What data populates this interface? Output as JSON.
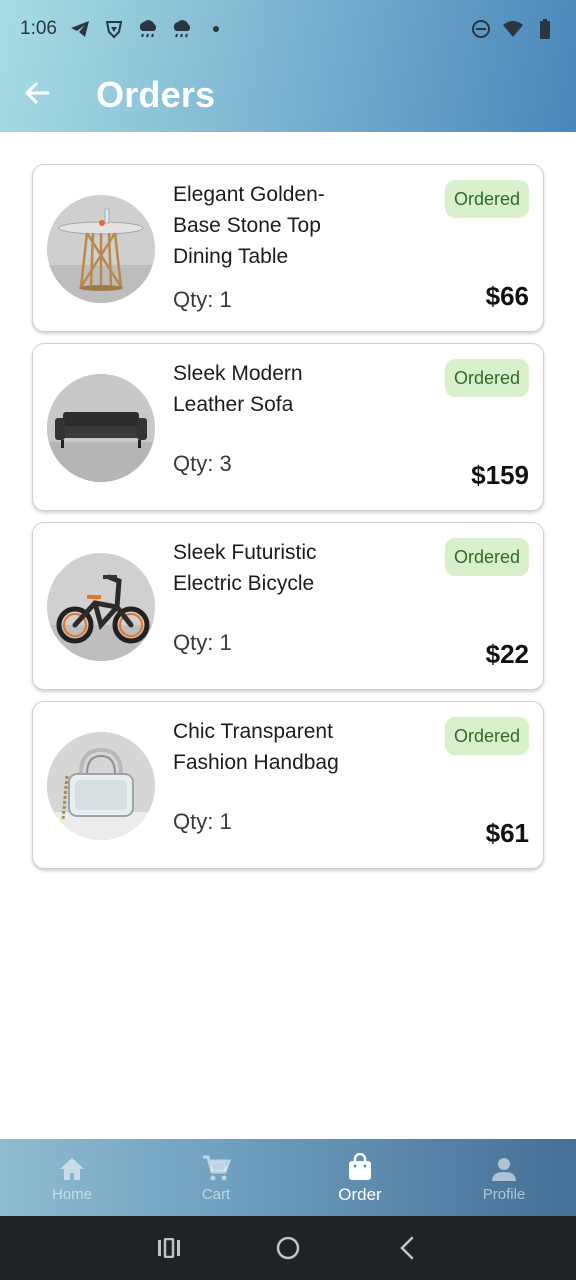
{
  "status_bar": {
    "time": "1:06",
    "icons_left": [
      "telegram-icon",
      "brave-icon",
      "weather-icon",
      "weather-icon",
      "dot-icon"
    ],
    "icons_right": [
      "dnd-icon",
      "wifi-icon",
      "battery-icon"
    ]
  },
  "header": {
    "title": "Orders",
    "back_icon": "arrow-left-icon",
    "gradient": [
      "#a7dde3",
      "#4a86ba"
    ]
  },
  "orders": [
    {
      "name_lines": [
        "Elegant Golden-",
        "Base Stone Top",
        "Dining Table"
      ],
      "qty_label": "Qty:",
      "qty": "1",
      "status": "Ordered",
      "price": "$66",
      "image": "dining-table-image"
    },
    {
      "name_lines": [
        "Sleek Modern",
        "Leather Sofa"
      ],
      "qty_label": "Qty:",
      "qty": "3",
      "status": "Ordered",
      "price": "$159",
      "image": "leather-sofa-image"
    },
    {
      "name_lines": [
        "Sleek Futuristic",
        "Electric Bicycle"
      ],
      "qty_label": "Qty:",
      "qty": "1",
      "status": "Ordered",
      "price": "$22",
      "image": "electric-bicycle-image"
    },
    {
      "name_lines": [
        "Chic Transparent",
        "Fashion Handbag"
      ],
      "qty_label": "Qty:",
      "qty": "1",
      "status": "Ordered",
      "price": "$61",
      "image": "handbag-image"
    }
  ],
  "bottom_nav": {
    "items": [
      {
        "label": "Home",
        "icon": "home-icon",
        "active": false
      },
      {
        "label": "Cart",
        "icon": "cart-icon",
        "active": false
      },
      {
        "label": "Order",
        "icon": "shopping-bag-icon",
        "active": true
      },
      {
        "label": "Profile",
        "icon": "person-icon",
        "active": false
      }
    ]
  },
  "system_nav": [
    "recents-icon",
    "home-circle-icon",
    "back-chevron-icon"
  ],
  "colors": {
    "badge_bg": "#d9f0cc",
    "badge_text": "#2e6b2a",
    "nav_gradient_start": "#8fbcd0",
    "nav_gradient_end": "#456f96"
  }
}
